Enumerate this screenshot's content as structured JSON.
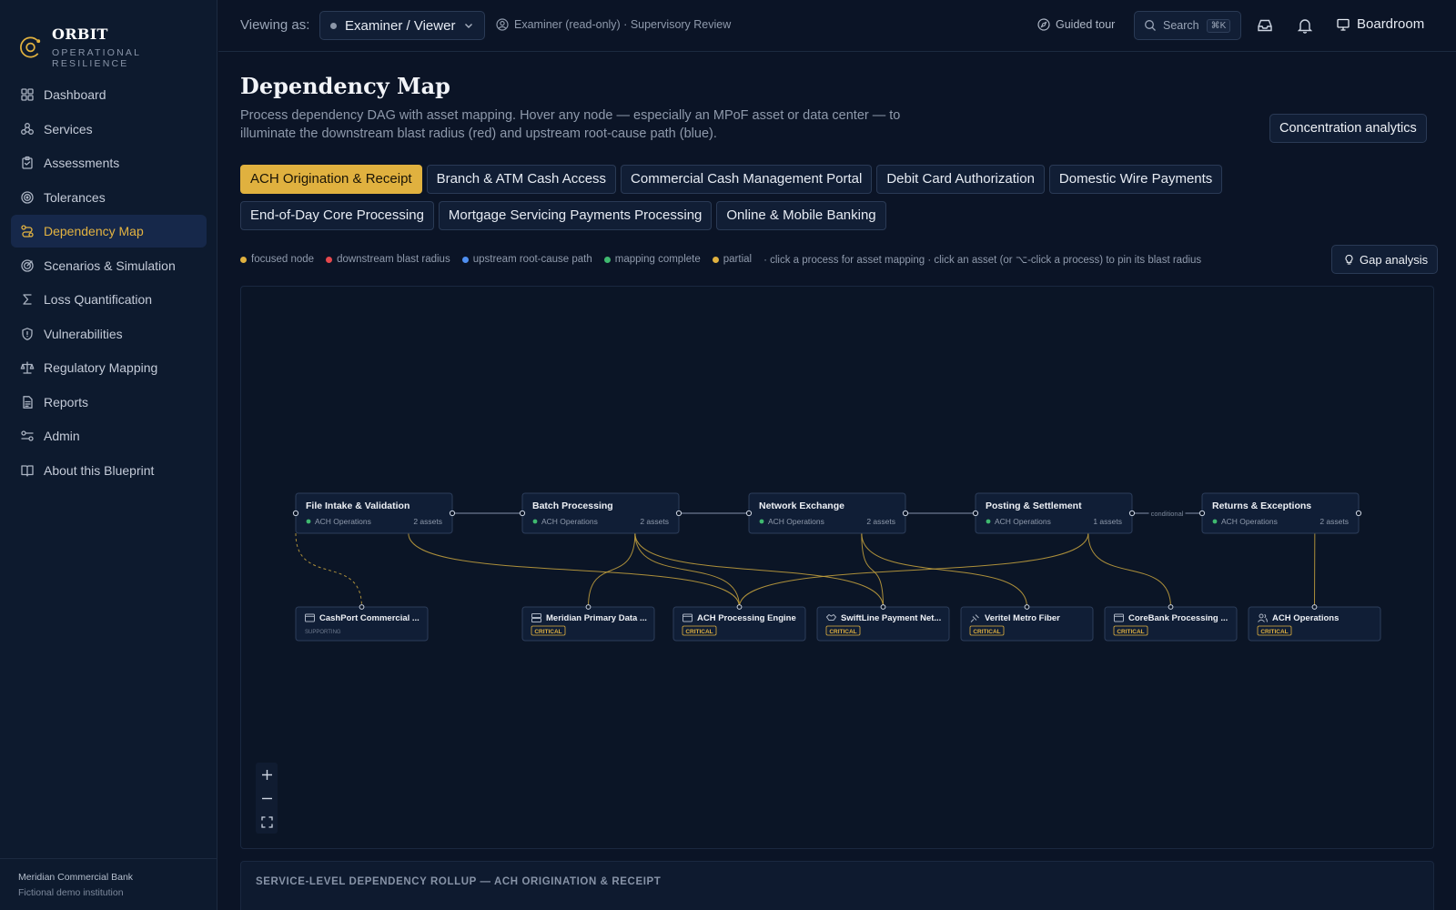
{
  "brand": {
    "name": "ORBIT",
    "subtitle": "OPERATIONAL RESILIENCE"
  },
  "sidebar": {
    "items": [
      {
        "label": "Dashboard",
        "icon": "dashboard-icon"
      },
      {
        "label": "Services",
        "icon": "services-icon"
      },
      {
        "label": "Assessments",
        "icon": "clipboard-icon"
      },
      {
        "label": "Tolerances",
        "icon": "target-icon"
      },
      {
        "label": "Dependency Map",
        "icon": "route-icon",
        "active": true
      },
      {
        "label": "Scenarios & Simulation",
        "icon": "radar-icon"
      },
      {
        "label": "Loss Quantification",
        "icon": "sigma-icon"
      },
      {
        "label": "Vulnerabilities",
        "icon": "shield-icon"
      },
      {
        "label": "Regulatory Mapping",
        "icon": "scale-icon"
      },
      {
        "label": "Reports",
        "icon": "report-icon"
      },
      {
        "label": "Admin",
        "icon": "admin-icon"
      },
      {
        "label": "About this Blueprint",
        "icon": "book-icon"
      }
    ],
    "footer": {
      "org": "Meridian Commercial Bank",
      "note": "Fictional demo institution"
    }
  },
  "topbar": {
    "viewing_label": "Viewing as:",
    "role": "Examiner / Viewer",
    "examiner_note": "Examiner (read-only) · Supervisory Review",
    "guided_tour": "Guided tour",
    "search_label": "Search",
    "search_shortcut": "⌘K",
    "boardroom": "Boardroom"
  },
  "page": {
    "title": "Dependency Map",
    "description": "Process dependency DAG with asset mapping. Hover any node — especially an MPoF asset or data center — to illuminate the downstream blast radius (red) and upstream root-cause path (blue).",
    "concentration_button": "Concentration analytics",
    "gap_button": "Gap analysis"
  },
  "services": [
    {
      "label": "ACH Origination & Receipt",
      "active": true
    },
    {
      "label": "Branch & ATM Cash Access"
    },
    {
      "label": "Commercial Cash Management Portal"
    },
    {
      "label": "Debit Card Authorization"
    },
    {
      "label": "Domestic Wire Payments"
    },
    {
      "label": "End-of-Day Core Processing"
    },
    {
      "label": "Mortgage Servicing Payments Processing"
    },
    {
      "label": "Online & Mobile Banking"
    }
  ],
  "legend": {
    "items": [
      {
        "label": "focused node",
        "color": "#e0b13f"
      },
      {
        "label": "downstream blast radius",
        "color": "#e5484d"
      },
      {
        "label": "upstream root-cause path",
        "color": "#4f8ff0"
      },
      {
        "label": "mapping complete",
        "color": "#3fb96f"
      },
      {
        "label": "partial",
        "color": "#e0b13f"
      }
    ],
    "hint": "· click a process for asset mapping · click an asset (or ⌥-click a process) to pin its blast radius"
  },
  "graph": {
    "processes": [
      {
        "name": "File Intake & Validation",
        "owner": "ACH Operations",
        "assets": "2 assets"
      },
      {
        "name": "Batch Processing",
        "owner": "ACH Operations",
        "assets": "2 assets"
      },
      {
        "name": "Network Exchange",
        "owner": "ACH Operations",
        "assets": "2 assets"
      },
      {
        "name": "Posting & Settlement",
        "owner": "ACH Operations",
        "assets": "1 assets"
      },
      {
        "name": "Returns & Exceptions",
        "owner": "ACH Operations",
        "assets": "2 assets"
      }
    ],
    "edge_label": "conditional",
    "assets": [
      {
        "name": "CashPort Commercial ...",
        "tag": "SUPPORTING",
        "icon": "app-window-icon"
      },
      {
        "name": "Meridian Primary Data ...",
        "tag": "CRITICAL",
        "icon": "server-icon"
      },
      {
        "name": "ACH Processing Engine",
        "tag": "CRITICAL",
        "icon": "app-window-icon"
      },
      {
        "name": "SwiftLine Payment Net...",
        "tag": "CRITICAL",
        "icon": "vendor-icon"
      },
      {
        "name": "Veritel Metro Fiber",
        "tag": "CRITICAL",
        "icon": "cable-icon"
      },
      {
        "name": "CoreBank Processing ...",
        "tag": "CRITICAL",
        "icon": "app-window-icon"
      },
      {
        "name": "ACH Operations",
        "tag": "CRITICAL",
        "icon": "people-icon"
      }
    ],
    "colors": {
      "owner_dot": "#3fb96f",
      "edge": "#c9a53e",
      "critical": "#e0b13f",
      "node_border": "#2c3d5a"
    }
  },
  "rollup": {
    "title": "SERVICE-LEVEL DEPENDENCY ROLLUP — ACH ORIGINATION & RECEIPT"
  }
}
